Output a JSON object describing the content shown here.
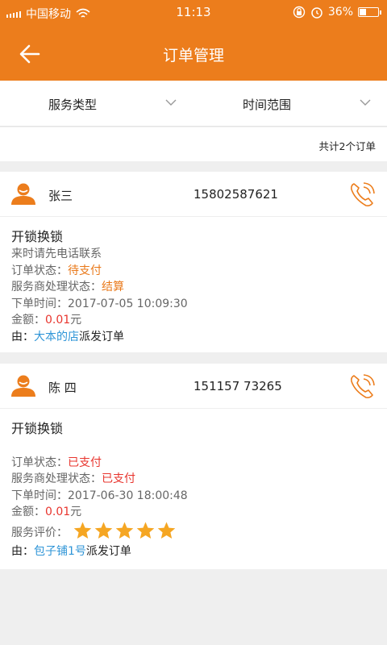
{
  "status_bar": {
    "carrier": "中国移动",
    "time": "11:13",
    "battery": "36%",
    "battery_level": 0.36
  },
  "header": {
    "title": "订单管理",
    "back_icon": "arrow-left-icon"
  },
  "filters": {
    "service_type": "服务类型",
    "time_range": "时间范围"
  },
  "total": "共计2个订单",
  "orders": [
    {
      "name": "张三",
      "phone": "15802587621",
      "service": "开锁换锁",
      "note": "来时请先电话联系",
      "status_label": "订单状态：",
      "status": "待支付",
      "status_color": "#e9791a",
      "provider_label": "服务商处理状态：",
      "provider_status": "结算",
      "provider_color": "#e9791a",
      "time_label": "下单时间：",
      "time": "2017-07-05 10:09:30",
      "amount_label": "金额：",
      "amount": "0.01",
      "amount_unit": "元",
      "from_prefix": "由：",
      "shop": "大本的店",
      "from_suffix": "派发订单"
    },
    {
      "name": "陈 四",
      "phone": "151157 73265",
      "service": "开锁换锁",
      "note": "",
      "status_label": "订单状态：",
      "status": "已支付",
      "status_color": "#e8352e",
      "provider_label": "服务商处理状态：",
      "provider_status": "已支付",
      "provider_color": "#e8352e",
      "time_label": "下单时间：",
      "time": "2017-06-30 18:00:48",
      "amount_label": "金额：",
      "amount": "0.01",
      "amount_unit": "元",
      "rating_label": "服务评价：",
      "rating": 5,
      "from_prefix": "由：",
      "shop": "包子铺1号",
      "from_suffix": "派发订单"
    }
  ],
  "icons": {
    "avatar": "person-avatar-icon",
    "call": "phone-icon",
    "star": "star-icon",
    "dropdown": "chevron-down-icon"
  },
  "colors": {
    "brand": "#ec7d1c",
    "link": "#2f95d7",
    "star": "#f5a623"
  }
}
